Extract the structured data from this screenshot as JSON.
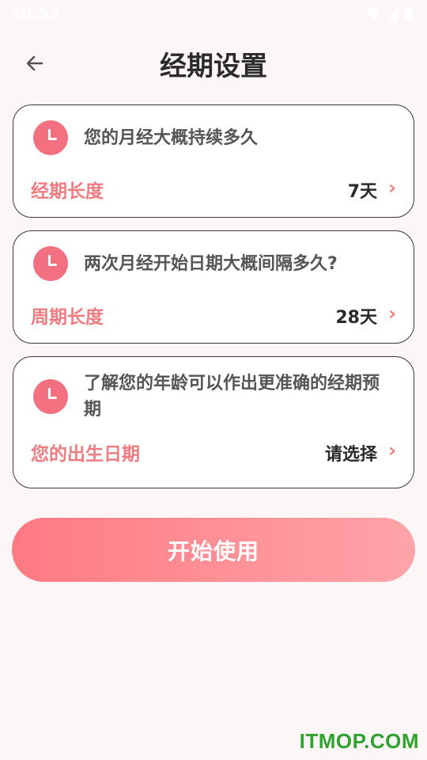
{
  "status_bar": {
    "time": "10:53",
    "icons": [
      "wifi-icon",
      "signal-icon",
      "battery-icon"
    ]
  },
  "header": {
    "back_icon": "back-arrow-icon",
    "title": "经期设置"
  },
  "cards": [
    {
      "icon": "clock-icon",
      "question": "您的月经大概持续多久",
      "label": "经期长度",
      "value": "7天",
      "chevron": "›"
    },
    {
      "icon": "clock-icon",
      "question": "两次月经开始日期大概间隔多久?",
      "label": "周期长度",
      "value": "28天",
      "chevron": "›"
    },
    {
      "icon": "clock-icon",
      "question": "了解您的年龄可以作出更准确的经期预期",
      "label": "您的出生日期",
      "value": "请选择",
      "chevron": "›"
    }
  ],
  "start_button": {
    "label": "开始使用"
  },
  "watermark": "ITMOP.COM",
  "colors": {
    "accent": "#f2707f",
    "label": "#ee7d82",
    "button_start": "#ff7a82",
    "button_end": "#ffa4aa",
    "background": "#fdf6f7",
    "watermark": "#2ea32e"
  }
}
